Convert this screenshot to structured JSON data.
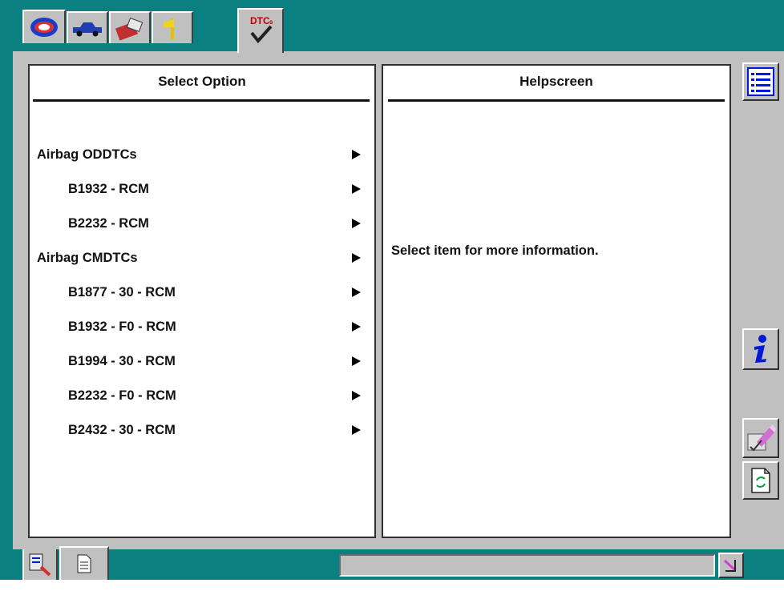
{
  "top_tabs": [
    {
      "icon": "globe-logo-icon"
    },
    {
      "icon": "car-icon"
    },
    {
      "icon": "toolbox-icon"
    },
    {
      "icon": "signpost-icon"
    },
    {
      "icon": "dtc-checkmark-icon",
      "label": "DTCs",
      "active": true
    }
  ],
  "left_panel": {
    "title": "Select Option",
    "items": [
      {
        "label": "Airbag ODDTCs",
        "level": 0
      },
      {
        "label": "B1932 - RCM",
        "level": 1
      },
      {
        "label": "B2232 - RCM",
        "level": 1
      },
      {
        "label": "Airbag CMDTCs",
        "level": 0
      },
      {
        "label": "B1877 - 30 - RCM",
        "level": 1
      },
      {
        "label": "B1932 - F0 - RCM",
        "level": 1
      },
      {
        "label": "B1994 - 30 - RCM",
        "level": 1
      },
      {
        "label": "B2232 - F0 - RCM",
        "level": 1
      },
      {
        "label": "B2432 - 30 - RCM",
        "level": 1
      }
    ]
  },
  "right_panel": {
    "title": "Helpscreen",
    "message": "Select item for more information."
  },
  "side_buttons": [
    "list-icon",
    "info-icon",
    "eraser-icon",
    "document-refresh-icon"
  ],
  "bottom_bar": {
    "tabs": [
      "tool-magnifier-icon",
      "document-icon"
    ],
    "status_text": "",
    "corner_icon": "wrench-corner-icon"
  },
  "colors": {
    "background_teal": "#0a8080",
    "panel_grey": "#c0c0c0",
    "accent_blue": "#0018d8"
  }
}
